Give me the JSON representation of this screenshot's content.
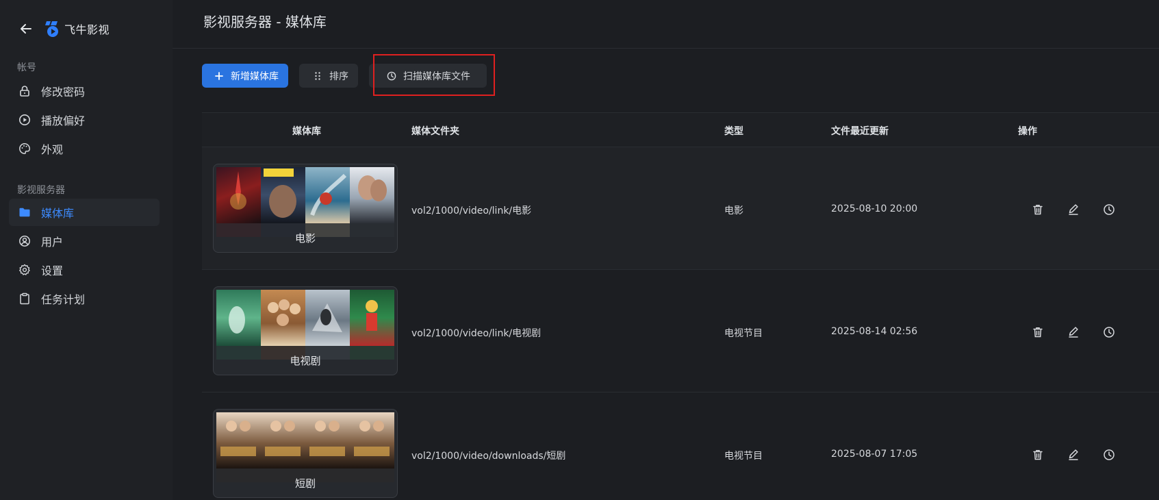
{
  "app": {
    "name": "飞牛影视"
  },
  "sidebar": {
    "sections": [
      {
        "label": "帐号"
      },
      {
        "label": "影视服务器"
      }
    ],
    "account_items": [
      {
        "label": "修改密码",
        "icon": "lock-icon"
      },
      {
        "label": "播放偏好",
        "icon": "play-circle-icon"
      },
      {
        "label": "外观",
        "icon": "palette-icon"
      }
    ],
    "server_items": [
      {
        "label": "媒体库",
        "icon": "folder-icon",
        "active": true
      },
      {
        "label": "用户",
        "icon": "user-icon"
      },
      {
        "label": "设置",
        "icon": "gear-icon"
      },
      {
        "label": "任务计划",
        "icon": "clipboard-icon"
      }
    ]
  },
  "main": {
    "title": "影视服务器 - 媒体库",
    "toolbar": {
      "add_label": "新增媒体库",
      "sort_label": "排序",
      "scan_label": "扫描媒体库文件"
    },
    "table": {
      "columns": [
        "媒体库",
        "媒体文件夹",
        "类型",
        "文件最近更新",
        "操作"
      ],
      "rows": [
        {
          "name": "电影",
          "folder": "vol2/1000/video/link/电影",
          "type": "电影",
          "updated": "2025-08-10 20:00"
        },
        {
          "name": "电视剧",
          "folder": "vol2/1000/video/link/电视剧",
          "type": "电视节目",
          "updated": "2025-08-14 02:56"
        },
        {
          "name": "短剧",
          "folder": "vol2/1000/video/downloads/短剧",
          "type": "电视节目",
          "updated": "2025-08-07 17:05"
        }
      ]
    }
  },
  "colors": {
    "accent": "#2a74e0",
    "active_text": "#3d8bff",
    "highlight": "#e02020",
    "background": "#1c1e22",
    "sidebar": "#1f2125"
  }
}
